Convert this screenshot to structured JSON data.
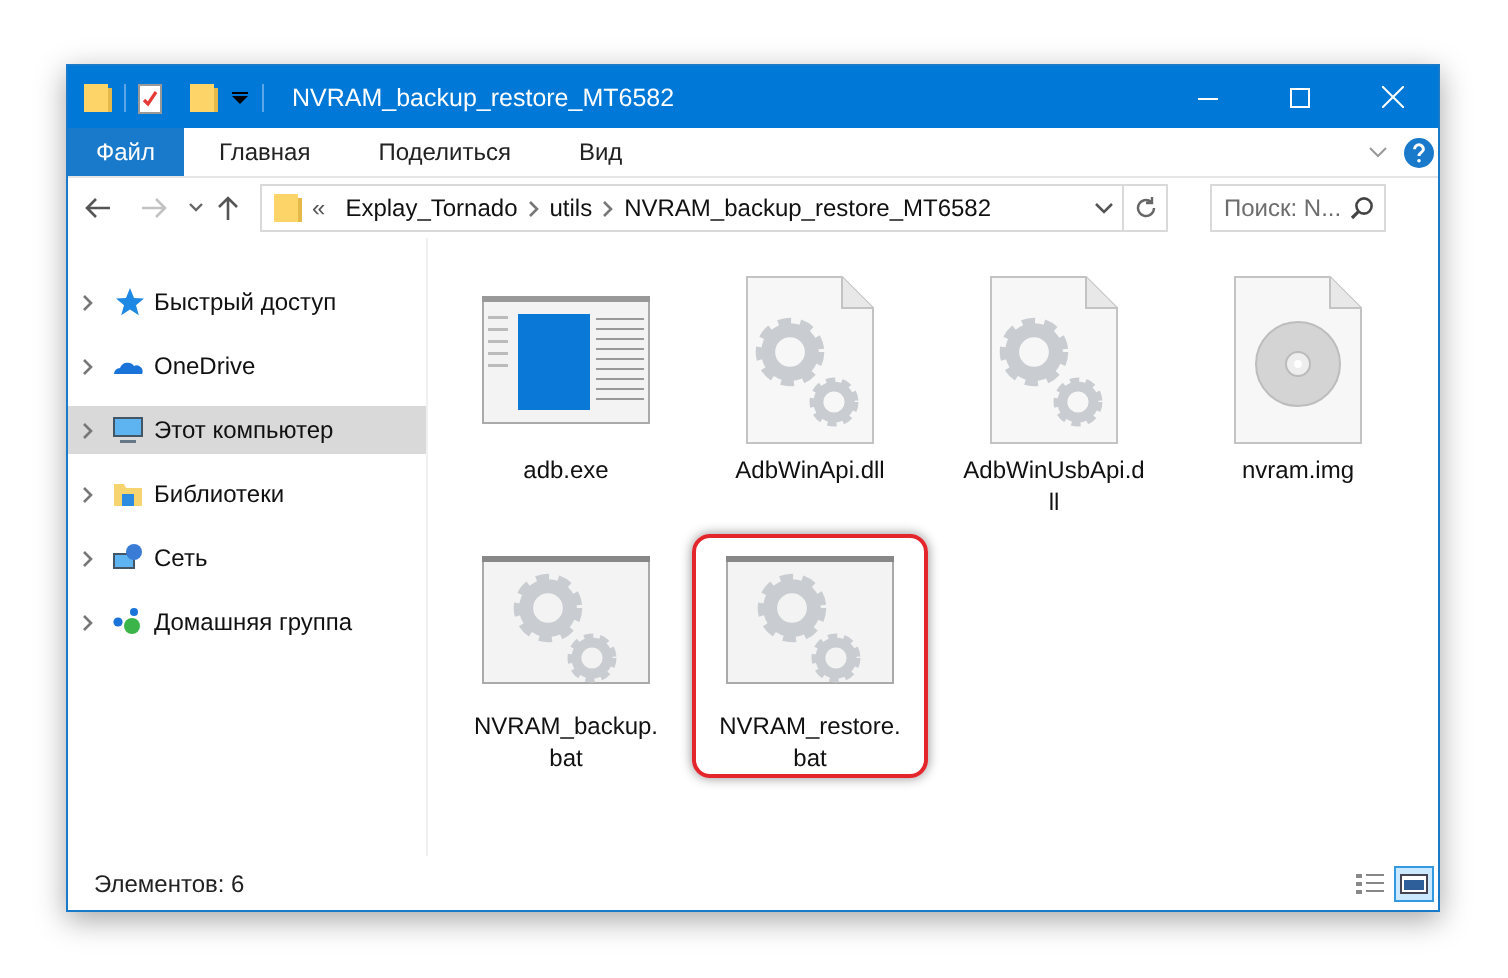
{
  "window": {
    "title": "NVRAM_backup_restore_MT6582"
  },
  "ribbon_tabs": [
    {
      "label": "Файл",
      "selected": true
    },
    {
      "label": "Главная",
      "selected": false
    },
    {
      "label": "Поделиться",
      "selected": false
    },
    {
      "label": "Вид",
      "selected": false
    }
  ],
  "address": {
    "overflow": "«",
    "segments": [
      "Explay_Tornado",
      "utils",
      "NVRAM_backup_restore_MT6582"
    ]
  },
  "search": {
    "placeholder": "Поиск: N..."
  },
  "sidebar": {
    "items": [
      {
        "label": "Быстрый доступ",
        "kind": "star",
        "selected": false
      },
      {
        "label": "OneDrive",
        "kind": "cloud",
        "selected": false
      },
      {
        "label": "Этот компьютер",
        "kind": "computer",
        "selected": true
      },
      {
        "label": "Библиотеки",
        "kind": "library",
        "selected": false
      },
      {
        "label": "Сеть",
        "kind": "network",
        "selected": false
      },
      {
        "label": "Домашняя группа",
        "kind": "homegroup",
        "selected": false
      }
    ]
  },
  "files": [
    {
      "name": "adb.exe",
      "kind": "app",
      "highlighted": false
    },
    {
      "name": "AdbWinApi.dll",
      "kind": "settings",
      "highlighted": false
    },
    {
      "name": "AdbWinUsbApi.d\nll",
      "kind": "settings",
      "highlighted": false
    },
    {
      "name": "nvram.img",
      "kind": "disc",
      "highlighted": false
    },
    {
      "name": "NVRAM_backup.\nbat",
      "kind": "batch",
      "highlighted": false
    },
    {
      "name": "NVRAM_restore.\nbat",
      "kind": "batch",
      "highlighted": true
    }
  ],
  "status_bar": {
    "count": "Элементов: 6",
    "views": [
      {
        "kind": "details",
        "selected": false
      },
      {
        "kind": "icons",
        "selected": true
      }
    ]
  }
}
